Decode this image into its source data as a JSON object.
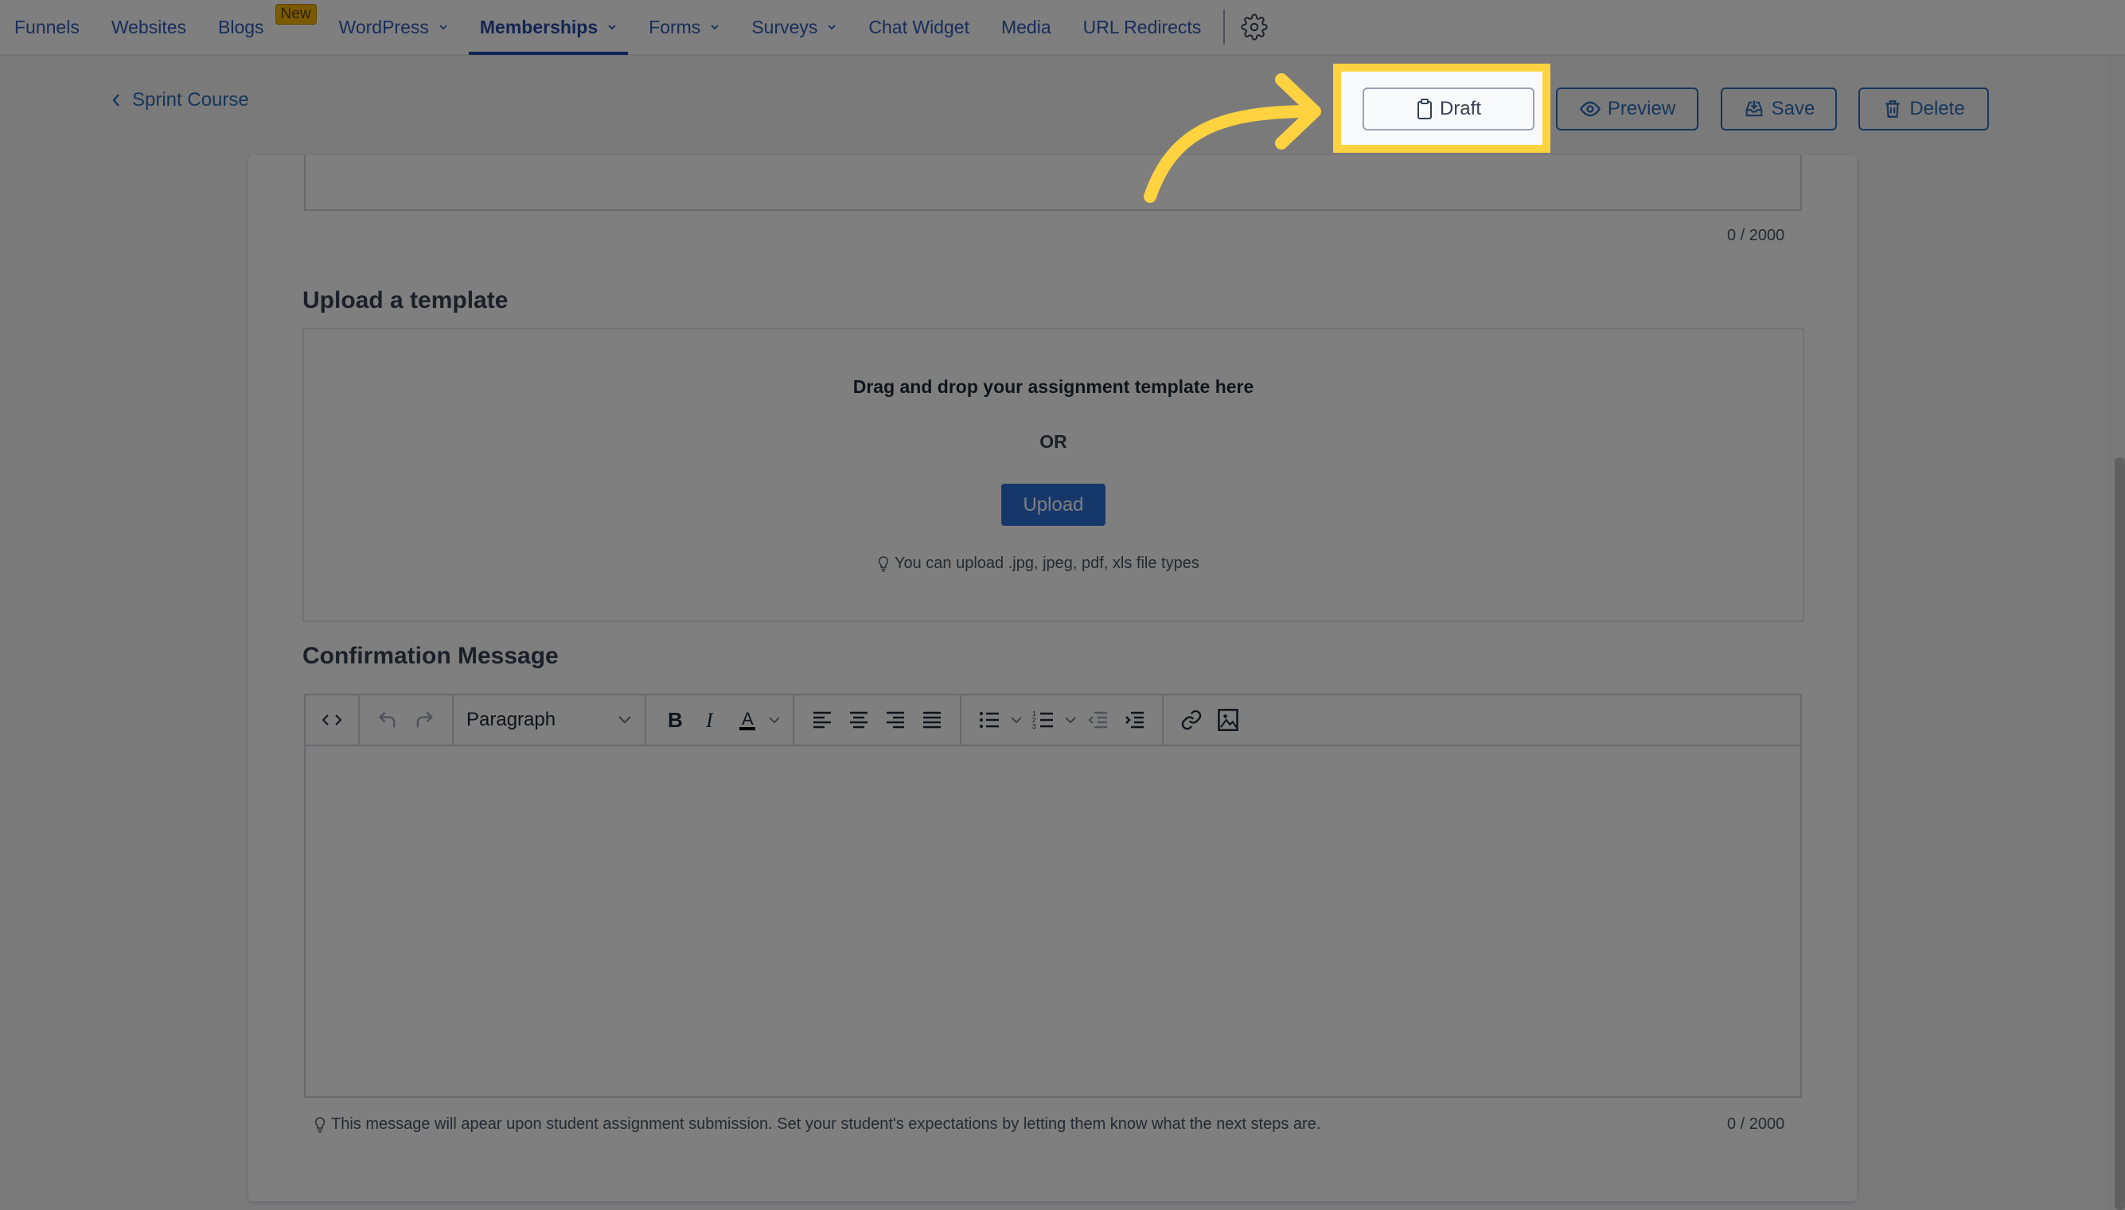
{
  "nav": {
    "items": [
      {
        "label": "Funnels",
        "has_dropdown": false,
        "active": false
      },
      {
        "label": "Websites",
        "has_dropdown": false,
        "active": false
      },
      {
        "label": "Blogs",
        "has_dropdown": false,
        "active": false,
        "badge": "New"
      },
      {
        "label": "WordPress",
        "has_dropdown": true,
        "active": false
      },
      {
        "label": "Memberships",
        "has_dropdown": true,
        "active": true
      },
      {
        "label": "Forms",
        "has_dropdown": true,
        "active": false
      },
      {
        "label": "Surveys",
        "has_dropdown": true,
        "active": false
      },
      {
        "label": "Chat Widget",
        "has_dropdown": false,
        "active": false
      },
      {
        "label": "Media",
        "has_dropdown": false,
        "active": false
      },
      {
        "label": "URL Redirects",
        "has_dropdown": false,
        "active": false
      }
    ],
    "settings_icon": "gear-icon"
  },
  "header": {
    "back_label": "Sprint Course",
    "actions": {
      "draft": "Draft",
      "preview": "Preview",
      "save": "Save",
      "delete": "Delete"
    }
  },
  "form": {
    "previous_counter": "0 / 2000",
    "upload_section": {
      "title": "Upload a template",
      "drag_text": "Drag and drop your assignment template here",
      "or_text": "OR",
      "upload_button": "Upload",
      "hint": "You can upload .jpg, jpeg, pdf, xls file types"
    },
    "confirmation_section": {
      "title": "Confirmation Message",
      "paragraph_select": "Paragraph",
      "body_value": "",
      "hint": "This message will apear upon student assignment submission. Set your student's expectations by letting them know what the next steps are.",
      "counter": "0 / 2000"
    }
  },
  "annotation": {
    "highlight_color": "#ffd23f",
    "target": "Draft"
  },
  "colors": {
    "link": "#2f6db5",
    "primary": "#2c6ed5",
    "nav_active": "#2449a8",
    "badge": "#f7b500"
  }
}
